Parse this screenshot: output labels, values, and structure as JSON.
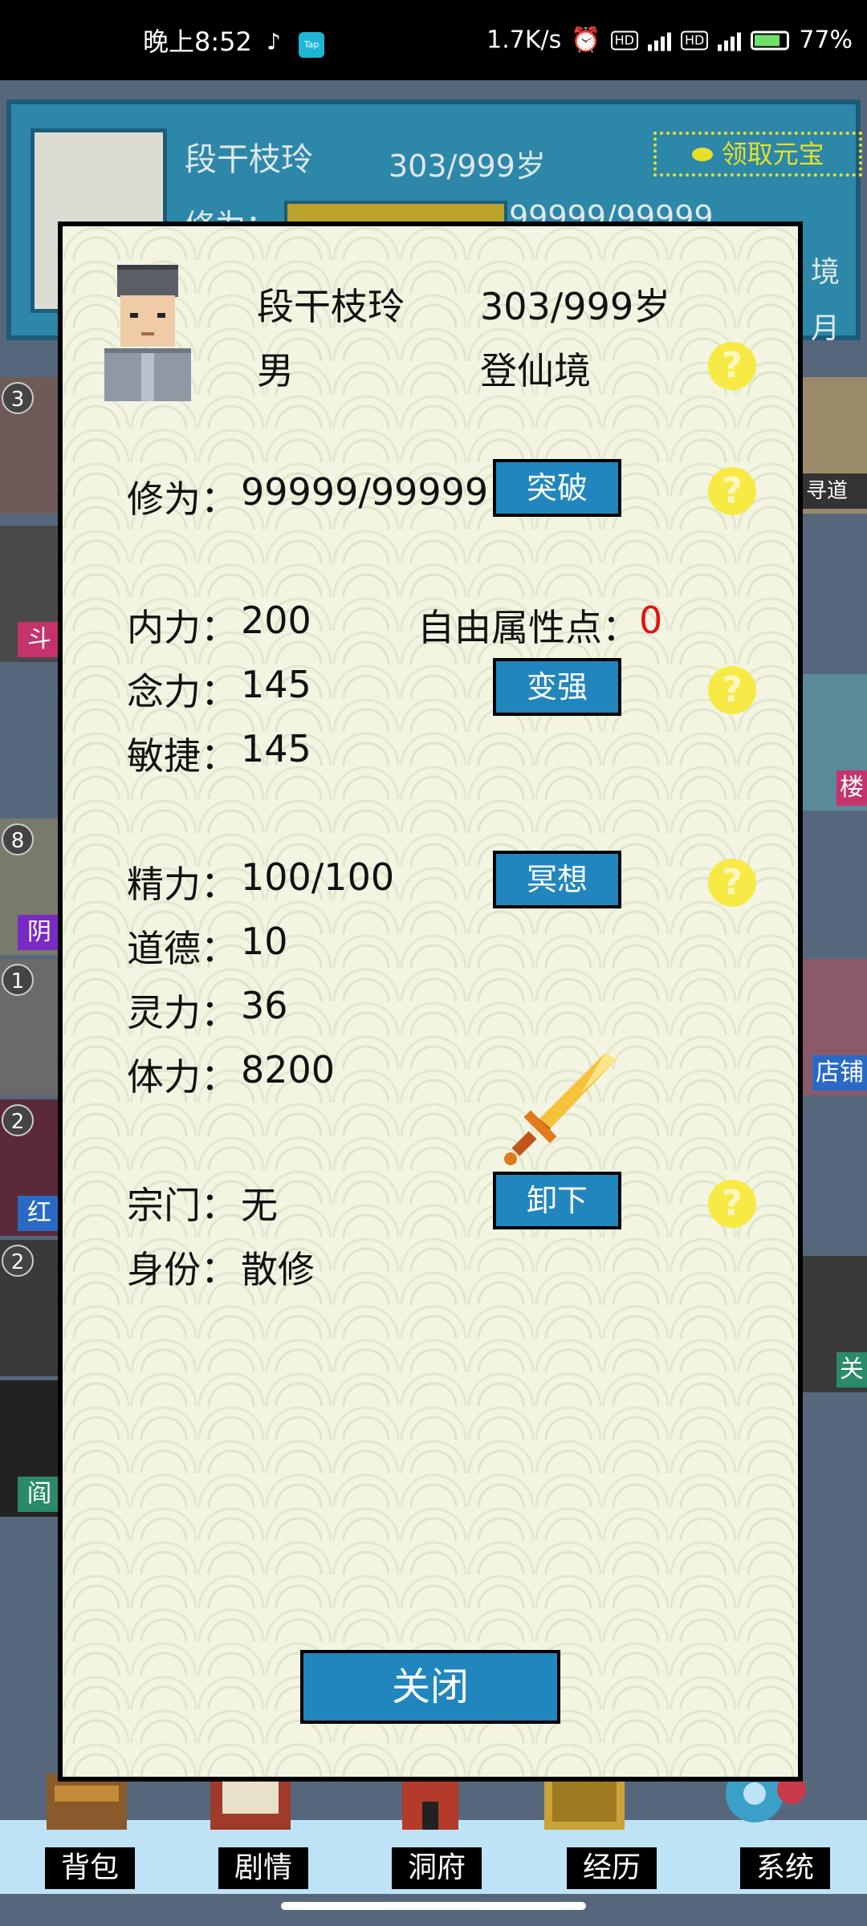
{
  "status_bar": {
    "time": "晚上8:52",
    "tiktok_icon": "tiktok-icon",
    "tap_icon": "Tap",
    "net_speed": "1.7K/s",
    "hd1": "HD",
    "hd2": "HD",
    "battery": "77%"
  },
  "background": {
    "name": "段干枝玲",
    "age": "303/999岁",
    "claim": "领取元宝",
    "xiuwei_label": "修为：",
    "xiuwei_value": "99999/99999",
    "side1": "境",
    "side2": "月",
    "left_tiles": [
      {
        "num": "3",
        "label": ""
      },
      {
        "num": "",
        "label": "斗"
      },
      {
        "num": "8",
        "label": "阴"
      },
      {
        "num": "1",
        "label": ""
      },
      {
        "num": "2",
        "label": "红"
      },
      {
        "num": "2",
        "label": "阎"
      }
    ],
    "right_tiles": [
      "寻道境",
      "楼",
      "店铺",
      "关"
    ],
    "nav": [
      "背包",
      "剧情",
      "洞府",
      "经历",
      "系统"
    ]
  },
  "dialog": {
    "name": "段干枝玲",
    "age": "303/999岁",
    "gender": "男",
    "realm": "登仙境",
    "xiuwei_label": "修为：",
    "xiuwei_value": "99999/99999",
    "breakthrough_btn": "突破",
    "neili_label": "内力：",
    "neili_value": "200",
    "free_points_label": "自由属性点：",
    "free_points_value": "0",
    "nianli_label": "念力：",
    "nianli_value": "145",
    "strengthen_btn": "变强",
    "minjie_label": "敏捷：",
    "minjie_value": "145",
    "jingli_label": "精力：",
    "jingli_value": "100/100",
    "meditate_btn": "冥想",
    "daode_label": "道德：",
    "daode_value": "10",
    "lingli_label": "灵力：",
    "lingli_value": "36",
    "tili_label": "体力：",
    "tili_value": "8200",
    "zongmen_label": "宗门：",
    "zongmen_value": "无",
    "unequip_btn": "卸下",
    "shenfen_label": "身份：",
    "shenfen_value": "散修",
    "help": "?",
    "close_btn": "关闭"
  },
  "colors": {
    "dialog_bg": "#f3f5e2",
    "button": "#2186bd",
    "help": "#f7ea45",
    "accent_red": "#e01414"
  }
}
